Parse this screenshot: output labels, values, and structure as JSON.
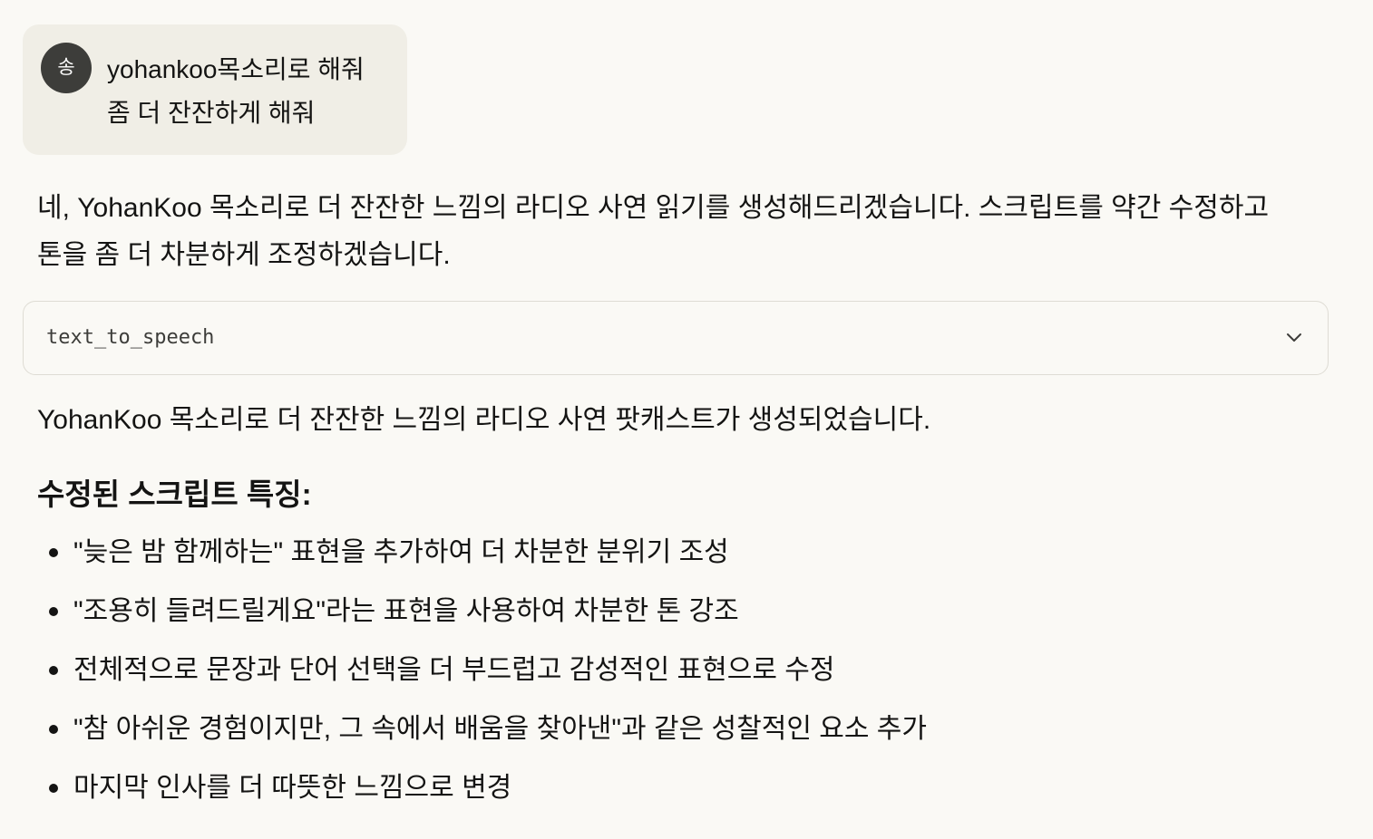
{
  "user_message": {
    "avatar_initial": "송",
    "lines": [
      "yohankoo목소리로 해줘",
      "좀 더 잔잔하게 해줘"
    ]
  },
  "assistant": {
    "intro": "네, YohanKoo 목소리로 더 잔잔한 느낌의 라디오 사연 읽기를 생성해드리겠습니다. 스크립트를 약간 수정하고 톤을 좀 더 차분하게 조정하겠습니다.",
    "tool_call": {
      "name": "text_to_speech",
      "toggle_icon": "chevron-down-icon"
    },
    "result": "YohanKoo 목소리로 더 잔잔한 느낌의 라디오 사연 팟캐스트가 생성되었습니다.",
    "heading": "수정된 스크립트 특징:",
    "features": [
      "\"늦은 밤 함께하는\" 표현을 추가하여 더 차분한 분위기 조성",
      "\"조용히 들려드릴게요\"라는 표현을 사용하여 차분한 톤 강조",
      "전체적으로 문장과 단어 선택을 더 부드럽고 감성적인 표현으로 수정",
      "\"참 아쉬운 경험이지만, 그 속에서 배움을 찾아낸\"과 같은 성찰적인 요소 추가",
      "마지막 인사를 더 따뜻한 느낌으로 변경"
    ]
  },
  "colors": {
    "background": "#faf9f5",
    "user_bubble": "#f0eee6",
    "avatar": "#3d3d3a",
    "text": "#141413",
    "border": "#dedcd4"
  }
}
